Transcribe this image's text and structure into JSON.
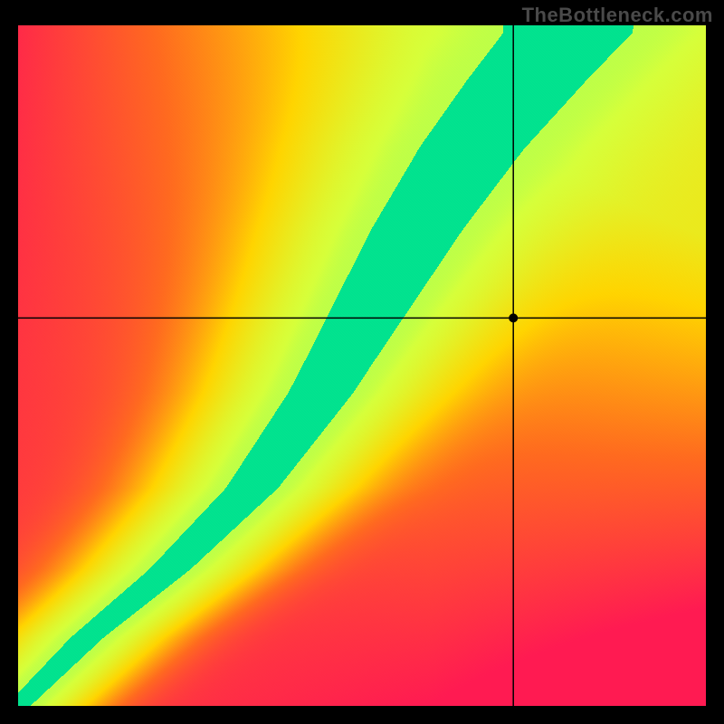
{
  "watermark": "TheBottleneck.com",
  "chart_data": {
    "type": "heatmap",
    "title": "",
    "xlabel": "",
    "ylabel": "",
    "xlim": [
      0,
      1
    ],
    "ylim": [
      0,
      1
    ],
    "gradient": {
      "stops": [
        {
          "t": 0.0,
          "color": "#ff1a52"
        },
        {
          "t": 0.25,
          "color": "#ff6a1f"
        },
        {
          "t": 0.5,
          "color": "#ffd400"
        },
        {
          "t": 0.75,
          "color": "#d6ff3a"
        },
        {
          "t": 0.9,
          "color": "#5eff7a"
        },
        {
          "t": 1.0,
          "color": "#00e28f"
        }
      ]
    },
    "ridge": {
      "points": [
        {
          "x": 0.02,
          "y": 0.02
        },
        {
          "x": 0.1,
          "y": 0.1
        },
        {
          "x": 0.22,
          "y": 0.2
        },
        {
          "x": 0.34,
          "y": 0.32
        },
        {
          "x": 0.44,
          "y": 0.46
        },
        {
          "x": 0.51,
          "y": 0.58
        },
        {
          "x": 0.58,
          "y": 0.7
        },
        {
          "x": 0.66,
          "y": 0.82
        },
        {
          "x": 0.74,
          "y": 0.92
        },
        {
          "x": 0.8,
          "y": 0.99
        }
      ],
      "width_profile": [
        {
          "y": 0.0,
          "w": 0.018
        },
        {
          "y": 0.2,
          "w": 0.03
        },
        {
          "y": 0.5,
          "w": 0.05
        },
        {
          "y": 0.8,
          "w": 0.075
        },
        {
          "y": 1.0,
          "w": 0.095
        }
      ]
    },
    "background_corners": {
      "top_left": "#ff1a52",
      "top_right": "#ffd400",
      "bottom_left": "#ff1a52",
      "bottom_right": "#ff1a52"
    },
    "crosshair": {
      "x": 0.72,
      "y": 0.57
    },
    "marker": {
      "x": 0.72,
      "y": 0.57,
      "radius_px": 5
    }
  }
}
